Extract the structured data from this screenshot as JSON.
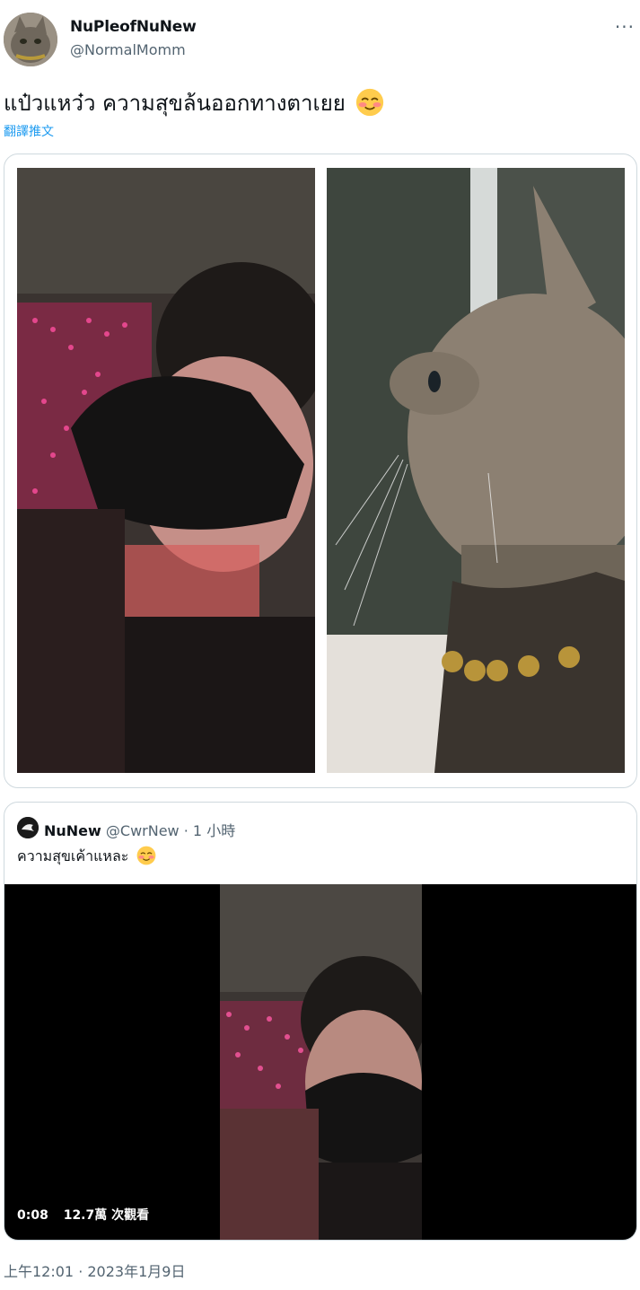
{
  "author": {
    "display_name": "NuPleofNuNew",
    "handle": "@NormalMomm",
    "avatar": "cat-avatar"
  },
  "more_button": "···",
  "tweet": {
    "text": "แป๋วแหว๋ว ความสุขล้นออกทางตาเยย",
    "emoji": "smiling-face-with-smiling-eyes",
    "translate_label": "翻譯推文"
  },
  "media": [
    {
      "subject": "masked person at concert"
    },
    {
      "subject": "tabby cat with gold bell collar"
    }
  ],
  "quoted_tweet": {
    "display_name": "NuNew",
    "handle": "@CwrNew",
    "separator": "·",
    "time_ago": "1 小時",
    "text": "ความสุขเค้าแหละ",
    "emoji": "smiling-face-with-smiling-eyes",
    "video": {
      "duration": "0:08",
      "views": "12.7萬 次觀看"
    }
  },
  "timestamp": "上午12:01 · 2023年1月9日",
  "colors": {
    "link": "#1d9bf0",
    "secondary_text": "#536471",
    "border": "#cfd9de",
    "primary_text": "#0f1419"
  }
}
